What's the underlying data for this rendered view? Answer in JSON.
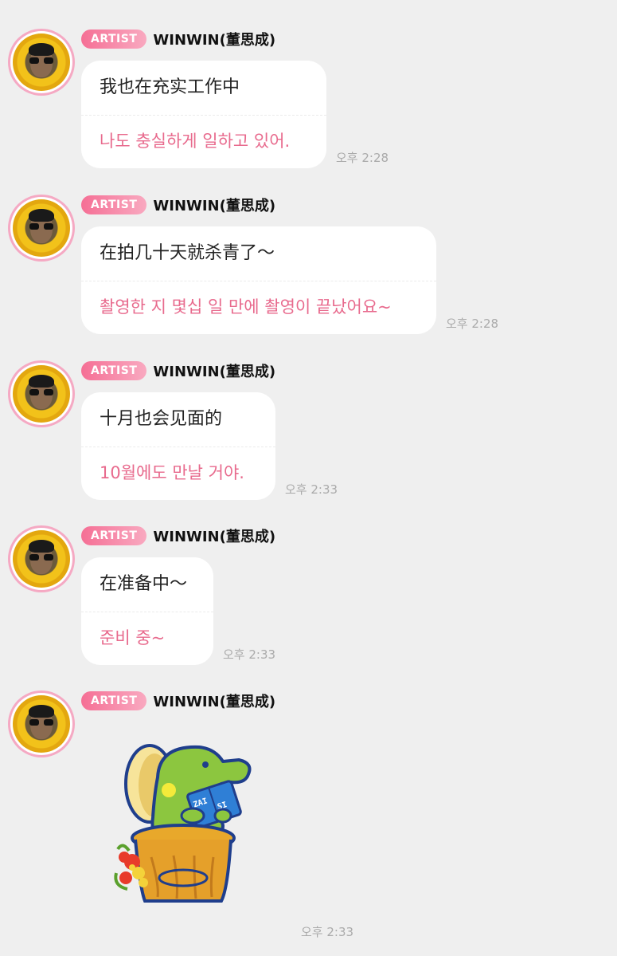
{
  "messages": [
    {
      "badge": "ARTIST",
      "name": "WINWIN(董思成)",
      "zh": "我也在充实工作中",
      "ko": "나도 충실하게 일하고 있어.",
      "time": "오후 2:28"
    },
    {
      "badge": "ARTIST",
      "name": "WINWIN(董思成)",
      "zh": "在拍几十天就杀青了～",
      "ko": "촬영한 지 몇십 일 만에 촬영이 끝났어요~",
      "time": "오후 2:28"
    },
    {
      "badge": "ARTIST",
      "name": "WINWIN(董思成)",
      "zh": "十月也会见面的",
      "ko": "10월에도 만날 거야.",
      "time": "오후 2:33"
    },
    {
      "badge": "ARTIST",
      "name": "WINWIN(董思成)",
      "zh": "在准备中～",
      "ko": "준비 중~",
      "time": "오후 2:33"
    },
    {
      "badge": "ARTIST",
      "name": "WINWIN(董思成)",
      "sticker": "dinosaur-reading-book-sticker",
      "sticker_text": "Zai Si Si",
      "time": "오후 2:33"
    }
  ],
  "colors": {
    "badge": "#f56f95",
    "translation": "#e86a8d",
    "background": "#efefef"
  }
}
